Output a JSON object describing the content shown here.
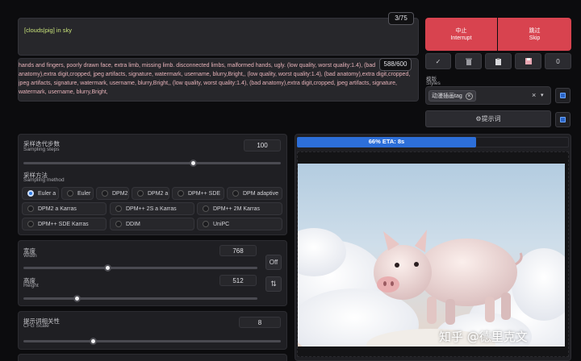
{
  "prompt": {
    "text": "[clouds|pig] in sky",
    "counter": "3/75"
  },
  "negative_prompt": {
    "text": "hands and fingers, poorly drawn face, extra limb, missing limb. disconnected limbs, malformed hands, ugly. (low quality, worst quality:1.4), (bad anatomy),extra digit,cropped, jpeg artifacts, signature, watermark, username, blurry,Bright,, (low quality, worst quality:1.4), (bad anatomy),extra digit,cropped, jpeg artifacts, signature, watermark, username, blurry,Bright,, (low quality, worst quality:1.4), (bad anatomy),extra digit,cropped, jpeg artifacts, signature, watermark, username, blurry,Bright,",
    "counter": "588/600"
  },
  "actions": {
    "interrupt_cn": "中止",
    "interrupt_en": "Interrupt",
    "skip_cn": "跳过",
    "skip_en": "Skip",
    "tool_icons": [
      "✓",
      "trash-icon",
      "clipboard-icon",
      "save-icon",
      "0"
    ]
  },
  "styles": {
    "label_cn": "模版",
    "label_en": "Styles",
    "selected_tag": "动漫插画tag",
    "tag_remove": "×",
    "clear": "×",
    "dropdown": "▾",
    "prompt_button": "⚙提示词"
  },
  "sampling_steps": {
    "label_cn": "采样迭代步数",
    "label_en": "Sampling steps",
    "value": "100",
    "slider_fraction": 0.66
  },
  "sampling_method": {
    "label_cn": "采样方法",
    "label_en": "Sampling method",
    "selected": "Euler a",
    "options": [
      "Euler a",
      "Euler",
      "DPM2",
      "DPM2 a",
      "DPM++ SDE",
      "DPM adaptive",
      "DPM2 a Karras",
      "DPM++ 2S a Karras",
      "DPM++ 2M Karras",
      "DPM++ SDE Karras",
      "DDIM",
      "UniPC"
    ]
  },
  "width": {
    "label_cn": "宽度",
    "label_en": "Width",
    "value": "768",
    "slider_fraction": 0.36
  },
  "height": {
    "label_cn": "高度",
    "label_en": "Height",
    "value": "512",
    "slider_fraction": 0.23
  },
  "off_button": "Off",
  "swap_button": "⇅",
  "cfg_scale": {
    "label_cn": "提示词相关性",
    "label_en": "CFG Scale",
    "value": "8",
    "slider_fraction": 0.27
  },
  "progress": {
    "text": "66% ETA: 8s",
    "fraction": 0.66
  },
  "watermark": "知乎 @德里克文",
  "colors": {
    "accent_red": "#d8434f",
    "progress_blue": "#2d6fd9",
    "prompt_text": "#c8e27a",
    "negative_text": "#e7b3ba"
  }
}
